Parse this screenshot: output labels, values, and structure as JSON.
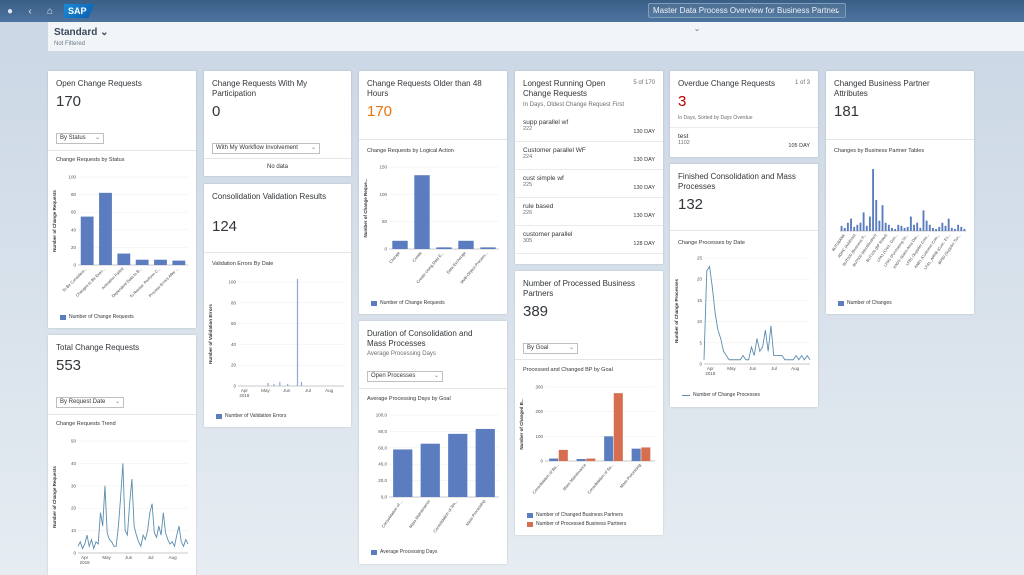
{
  "shell": {
    "logo": "SAP",
    "app_title": "Master Data Process Overview for Business Partner",
    "icons": [
      "user-icon",
      "back-icon",
      "home-icon"
    ]
  },
  "header": {
    "variant": "Standard",
    "filter_status": "Not Filtered"
  },
  "cards": {
    "open_cr": {
      "title": "Open Change Requests",
      "value": "170",
      "select": "By Status",
      "chart_title": "Change Requests by Status",
      "legend": "Number of Change Requests",
      "chart_data": {
        "type": "bar",
        "ylabel": "Number of Change Requests",
        "categories": [
          "To Be Considere...",
          "Changes to Be Exec...",
          "Activation Failed",
          "Dependent Data to B...",
          "To Revise: Perform C...",
          "Process Errors After ..."
        ],
        "values": [
          55,
          82,
          13,
          6,
          6,
          5
        ],
        "ylim": [
          0,
          100
        ],
        "yticks": [
          "0",
          "20",
          "40",
          "60",
          "80",
          "100"
        ]
      }
    },
    "total_cr": {
      "title": "Total Change Requests",
      "value": "553",
      "select": "By Request Date",
      "chart_title": "Change Requests Trend",
      "chart_data": {
        "type": "line",
        "ylabel": "Number of Change Requests",
        "ylim": [
          0,
          50
        ],
        "yticks": [
          "0",
          "10",
          "20",
          "30",
          "40",
          "50"
        ],
        "xticks": [
          "Apr\n2018",
          "May",
          "Jun",
          "Jul",
          "Aug"
        ],
        "values": [
          3,
          5,
          2,
          4,
          8,
          3,
          6,
          2,
          5,
          4,
          18,
          12,
          30,
          9,
          6,
          5,
          3,
          3,
          12,
          25,
          40,
          10,
          8,
          22,
          33,
          12,
          8,
          5,
          3,
          8,
          6,
          10,
          18,
          22,
          9,
          7,
          12,
          8,
          18,
          9,
          6,
          4,
          5,
          3,
          8,
          12,
          5,
          3,
          6,
          4
        ]
      }
    },
    "cr_participation": {
      "title": "Change Requests With My Participation",
      "value": "0",
      "select": "With My Workflow Involvement",
      "empty": "No data"
    },
    "consolidation": {
      "title": "Consolidation Validation Results",
      "value": "124",
      "chart_title": "Validation Errors By Date",
      "legend": "Number of Validation Errors",
      "chart_data": {
        "type": "bar",
        "ylabel": "Number of Validation Errors",
        "ylim": [
          0,
          100
        ],
        "yticks": [
          "0",
          "20",
          "40",
          "60",
          "80",
          "100"
        ],
        "xticks": [
          "Apr\n2018",
          "May",
          "Jun",
          "Jul",
          "Aug"
        ],
        "values": [
          0,
          0,
          0,
          0,
          0,
          0,
          0,
          0,
          0,
          0,
          0,
          0,
          0,
          0,
          0,
          3,
          0,
          0,
          2,
          0,
          0,
          4,
          0,
          0,
          0,
          2,
          0,
          0,
          0,
          0,
          103,
          0,
          4,
          0,
          0,
          0,
          0,
          0,
          0,
          0,
          0,
          0,
          0,
          0,
          0,
          0,
          0,
          0,
          0,
          0,
          0,
          0,
          0,
          0
        ]
      }
    },
    "older_48": {
      "title": "Change Requests Older than 48 Hours",
      "value": "170",
      "chart_title": "Change Requests by Logical Action",
      "legend": "Number of Change Requests",
      "chart_data": {
        "type": "bar",
        "ylabel": "Number of Change Reque...",
        "ylim": [
          0,
          150
        ],
        "yticks": [
          "0",
          "50",
          "100",
          "150"
        ],
        "categories": [
          "Change",
          "Create",
          "Create Using Data E...",
          "Data Exchange",
          "Multi-Object Process..."
        ],
        "values": [
          15,
          135,
          3,
          15,
          3
        ]
      }
    },
    "duration": {
      "title": "Duration of Consolidation and Mass Processes",
      "subtitle": "Average Processing Days",
      "select": "Open Processes",
      "chart_title": "Average Processing Days by Goal",
      "legend": "Average Processing Days",
      "chart_data": {
        "type": "bar",
        "ylim": [
          0,
          100
        ],
        "yticks": [
          "0,0",
          "20,0",
          "40,0",
          "60,0",
          "80,0",
          "100,0"
        ],
        "categories": [
          "Consolidation of ...",
          "Mass Maintenance",
          "Consolidation of Sm...",
          "Mass Processing"
        ],
        "values": [
          58,
          65,
          77,
          83
        ]
      }
    },
    "longest": {
      "title": "Longest Running Open Change Requests",
      "count": "5 of 170",
      "subtitle": "In Days, Oldest Change Request First",
      "items": [
        {
          "name": "supp parallel wf",
          "id": "222",
          "days": "130 DAY"
        },
        {
          "name": "Customer parallel WF",
          "id": "224",
          "days": "130 DAY"
        },
        {
          "name": "cust simple wf",
          "id": "225",
          "days": "130 DAY"
        },
        {
          "name": "rule based",
          "id": "226",
          "days": "130 DAY"
        },
        {
          "name": "customer parallel",
          "id": "305",
          "days": "128 DAY"
        }
      ]
    },
    "processed_bp": {
      "title": "Number of Processed Business Partners",
      "value": "389",
      "select": "By Goal",
      "chart_title": "Processed and Changed BP by Goal",
      "legend": [
        "Number of Changed Business Partners",
        "Number of Processed Business Partners"
      ],
      "colors": [
        "#5b7dbf",
        "#d76e4f"
      ],
      "chart_data": {
        "type": "bar",
        "ylabel": "Number of Changed B...",
        "ylim": [
          0,
          300
        ],
        "yticks": [
          "0",
          "100",
          "200",
          "300"
        ],
        "categories": [
          "Consolidation of Bu...",
          "Mass Maintenance",
          "Consolidation of Su...",
          "Mass Processing"
        ],
        "series": [
          {
            "name": "Number of Changed Business Partners",
            "values": [
              10,
              8,
              100,
              50
            ]
          },
          {
            "name": "Number of Processed Business Partners",
            "values": [
              45,
              10,
              275,
              55
            ]
          }
        ]
      }
    },
    "overdue": {
      "title": "Overdue Change Requests",
      "count": "1 of 3",
      "value": "3",
      "subtitle": "In Days, Sorted by Days Overdue",
      "item": {
        "name": "test",
        "id": "1102",
        "days": "105 DAY"
      }
    },
    "finished": {
      "title": "Finished Consolidation and Mass Processes",
      "value": "132",
      "chart_title": "Change Processes by Date",
      "legend": "Number of Change Processes",
      "chart_data": {
        "type": "line",
        "ylabel": "Number of Change Processes",
        "ylim": [
          0,
          25
        ],
        "yticks": [
          "0",
          "5",
          "10",
          "15",
          "20",
          "25"
        ],
        "xticks": [
          "Apr\n2018",
          "May",
          "Jun",
          "Jul",
          "Aug"
        ],
        "values": [
          1,
          22,
          23,
          18,
          12,
          8,
          6,
          3,
          2,
          1,
          1,
          1,
          1,
          1,
          2,
          1,
          1,
          4,
          2,
          6,
          3,
          4,
          8,
          3,
          9,
          2,
          2,
          2,
          2,
          1,
          1,
          1,
          1,
          2,
          1,
          2,
          1,
          2,
          1
        ]
      }
    },
    "changed_bp": {
      "title": "Changed Business Partner Attributes",
      "value": "181",
      "chart_title": "Changes by Business Partner Tables",
      "legend": "Number of Changes",
      "chart_data": {
        "type": "bar",
        "categories": [
          "BUT0BANK",
          "ADRC (Address)",
          "BUT000 (Business P...",
          "BUT000 (Identification)",
          "BUT100 (BP Roles)",
          "LFA1 (Cred.: Gen...",
          "LFM1 (Purchasing Or...",
          "KNVV (Sales Area Dat...",
          "LFB1 (Supplier Com...",
          "KNB1 (Customer Com...",
          "LFA1_ARRB (Cust.: Ex...",
          "BP5D (Supplier Tax..."
        ],
        "values": [
          5,
          3,
          8,
          12,
          4,
          6,
          8,
          18,
          5,
          14,
          60,
          30,
          10,
          25,
          8,
          6,
          3,
          2,
          6,
          5,
          3,
          4,
          14,
          6,
          8,
          3,
          20,
          10,
          6,
          3,
          2,
          4,
          8,
          5,
          12,
          3,
          2,
          6,
          4,
          2
        ]
      }
    }
  }
}
